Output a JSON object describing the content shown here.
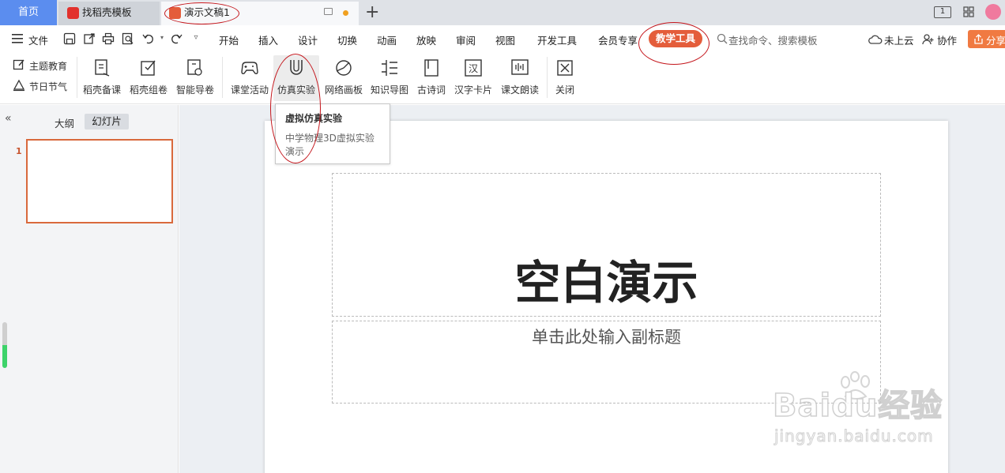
{
  "tabs": {
    "home": "首页",
    "daoke": "找稻壳模板",
    "doc": "演示文稿1"
  },
  "topright": {
    "page_badge": "1"
  },
  "menu": {
    "file": "文件",
    "items": [
      "开始",
      "插入",
      "设计",
      "切换",
      "动画",
      "放映",
      "审阅",
      "视图",
      "开发工具",
      "会员专享"
    ],
    "active": "教学工具",
    "search_placeholder": "查找命令、搜索模板",
    "cloud": "未上云",
    "collab": "协作",
    "share": "分享"
  },
  "tools": {
    "small": [
      "主题教育",
      "节日节气"
    ],
    "items": [
      "稻壳备课",
      "稻壳组卷",
      "智能导卷",
      "课堂活动",
      "仿真实验",
      "网络画板",
      "知识导图",
      "古诗词",
      "汉字卡片",
      "课文朗读",
      "关闭"
    ]
  },
  "tooltip": {
    "title": "虚拟仿真实验",
    "desc": "中学物理3D虚拟实验演示"
  },
  "leftpanel": {
    "outline": "大纲",
    "slides": "幻灯片",
    "slide_number": "1"
  },
  "slide": {
    "title": "空白演示",
    "subtitle": "单击此处输入副标题"
  },
  "watermark": {
    "brand": "Baidu经验",
    "url": "jingyan.baidu.com"
  },
  "colors": {
    "accent": "#e45d3b",
    "home_tab": "#5b8def",
    "annotation": "#c4161c"
  }
}
